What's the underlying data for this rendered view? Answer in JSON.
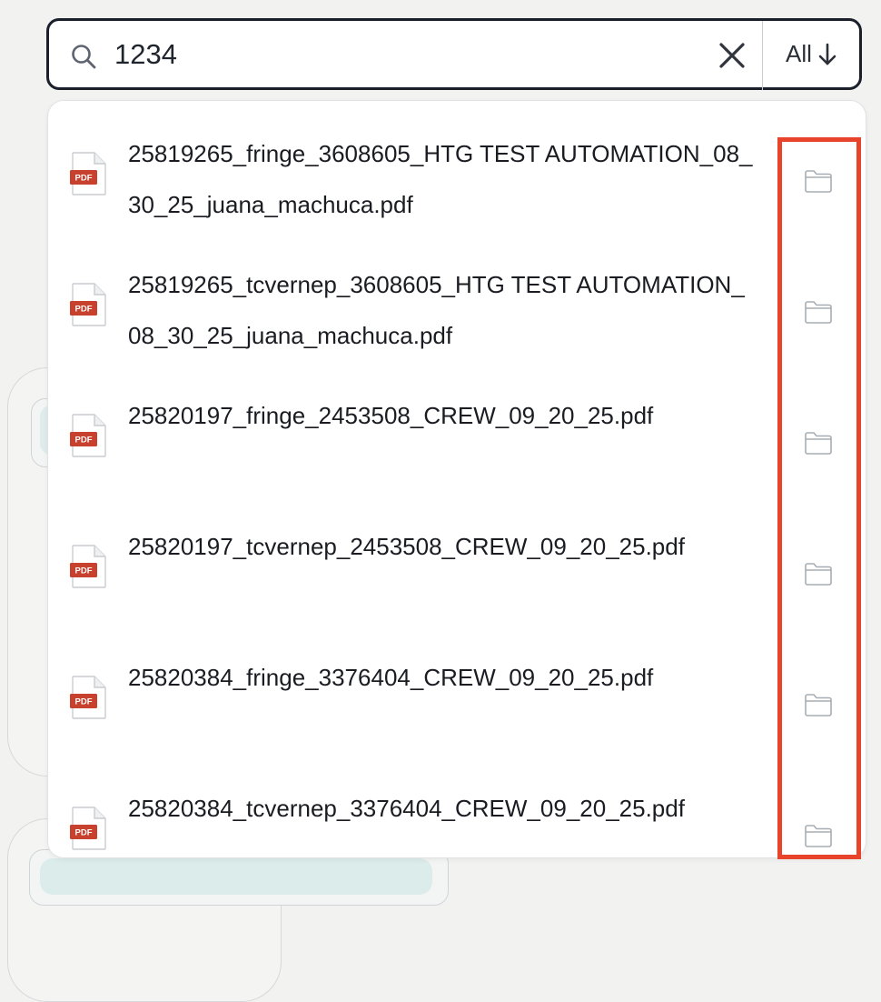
{
  "search": {
    "query": "1234",
    "filter_label": "All"
  },
  "results": [
    {
      "file_name": "25819265_fringe_3608605_HTG TEST AUTOMATION_08_30_25_juana_machuca.pdf",
      "badge": "PDF"
    },
    {
      "file_name": "25819265_tcvernep_3608605_HTG TEST AUTOMATION_08_30_25_juana_machuca.pdf",
      "badge": "PDF"
    },
    {
      "file_name": "25820197_fringe_2453508_CREW_09_20_25.pdf",
      "badge": "PDF"
    },
    {
      "file_name": "25820197_tcvernep_2453508_CREW_09_20_25.pdf",
      "badge": "PDF"
    },
    {
      "file_name": "25820384_fringe_3376404_CREW_09_20_25.pdf",
      "badge": "PDF"
    },
    {
      "file_name": "25820384_tcvernep_3376404_CREW_09_20_25.pdf",
      "badge": "PDF"
    }
  ],
  "icons": {
    "search": "search-icon",
    "clear": "close-icon",
    "sort": "arrow-down-icon",
    "file": "pdf-file-icon",
    "open_location": "folder-icon"
  },
  "colors": {
    "search_border": "#1b1f2b",
    "pdf_badge": "#c8412f",
    "highlight": "#e8442c",
    "background": "#f2f2f1"
  }
}
